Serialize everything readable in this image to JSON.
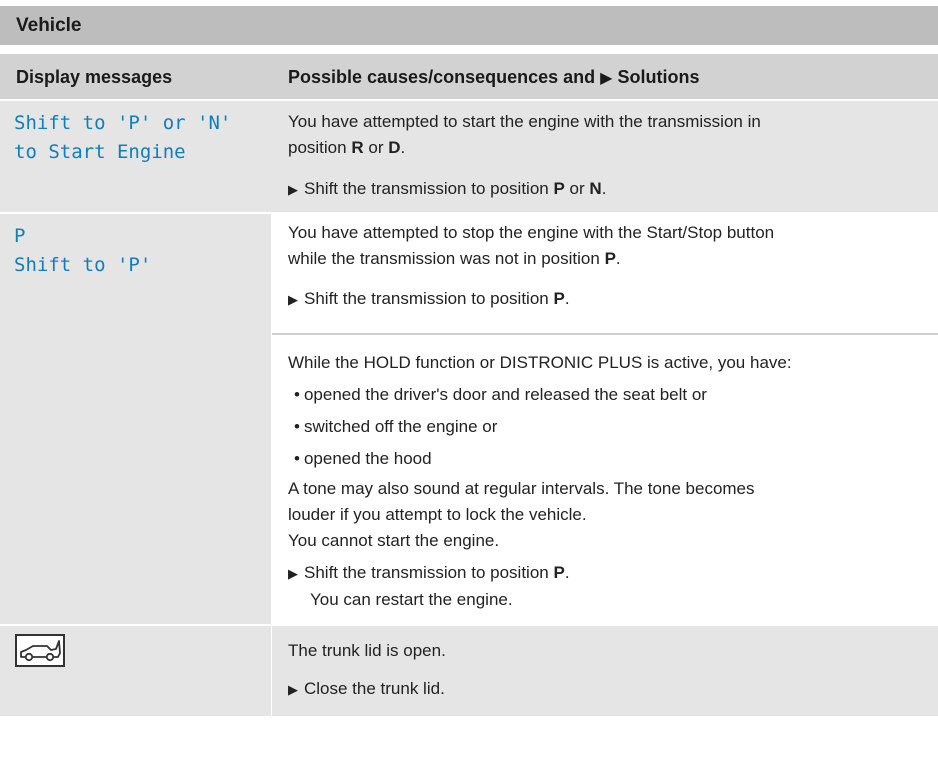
{
  "section": {
    "title": "Vehicle"
  },
  "header": {
    "col1": "Display messages",
    "col2_prefix": "Possible causes/consequences and",
    "col2_suffix": "Solutions"
  },
  "row1": {
    "message_line1": "Shift to 'P' or 'N'",
    "message_line2": "to Start Engine",
    "cause_line1": "You have attempted to start the engine with the transmission in",
    "cause_line2_a": "position",
    "cause_line2_b": "R",
    "cause_line2_c": "or",
    "cause_line2_d": "D",
    "cause_line2_e": ".",
    "solution_a": "Shift the transmission to position",
    "solution_b": "P",
    "solution_c": "or",
    "solution_d": "N",
    "solution_e": "."
  },
  "row2": {
    "message_line1": "P",
    "message_line2": "Shift to 'P'",
    "a_line1": "You have attempted to stop the engine with the Start/Stop button",
    "a_line2_a": "while the transmission was not in position",
    "a_line2_b": "P",
    "a_line2_c": ".",
    "a_solution_a": "Shift the transmission to position",
    "a_solution_b": "P",
    "a_solution_c": ".",
    "b_intro": "While the HOLD function or DISTRONIC PLUS is active, you have:",
    "b_bullets": [
      "opened the driver's door and released the seat belt or",
      "switched off the engine or",
      "opened the hood"
    ],
    "b_tone_line1": "A tone may also sound at regular intervals. The tone becomes",
    "b_tone_line2": "louder if you attempt to lock the vehicle.",
    "b_cannot": "You cannot start the engine.",
    "b_solution_a": "Shift the transmission to position",
    "b_solution_b": "P",
    "b_solution_c": ".",
    "b_solution_line2": "You can restart the engine."
  },
  "row3": {
    "icon": "car-trunk-open-icon",
    "cause": "The trunk lid is open.",
    "solution": "Close the trunk lid."
  },
  "colors": {
    "section_bg": "#bdbdbd",
    "header_bg": "#d2d2d2",
    "row_bg": "#e5e5e5",
    "message_text": "#0e7fb8"
  }
}
